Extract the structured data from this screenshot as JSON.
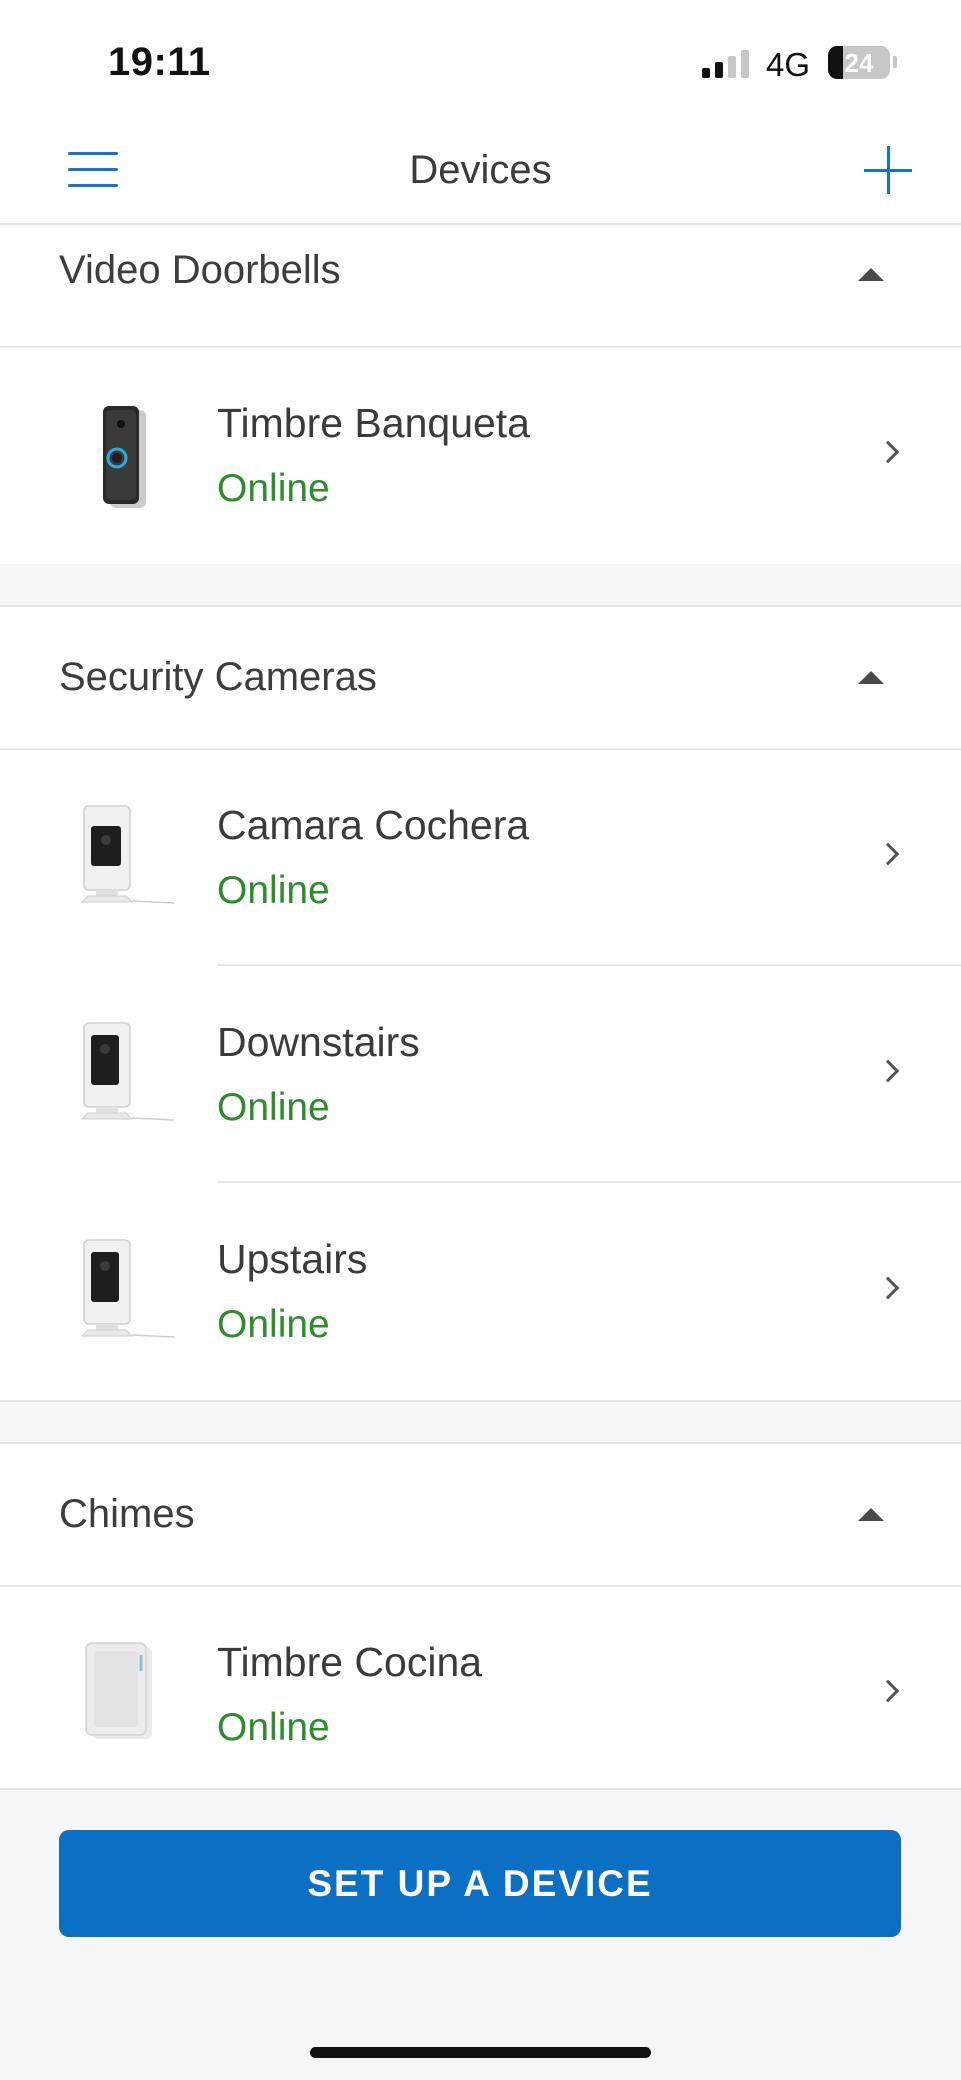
{
  "status_bar": {
    "time": "19:11",
    "network": "4G",
    "battery": "24",
    "battery_level_percent": 24
  },
  "header": {
    "title": "Devices",
    "menu_icon": "hamburger-menu-icon",
    "add_icon": "plus-icon"
  },
  "sections": [
    {
      "title": "Video Doorbells",
      "devices": [
        {
          "name": "Timbre Banqueta",
          "status": "Online",
          "icon": "video-doorbell-icon"
        }
      ]
    },
    {
      "title": "Security Cameras",
      "devices": [
        {
          "name": "Camara Cochera",
          "status": "Online",
          "icon": "indoor-camera-icon"
        },
        {
          "name": "Downstairs",
          "status": "Online",
          "icon": "indoor-camera-icon"
        },
        {
          "name": "Upstairs",
          "status": "Online",
          "icon": "indoor-camera-icon"
        }
      ]
    },
    {
      "title": "Chimes",
      "devices": [
        {
          "name": "Timbre Cocina",
          "status": "Online",
          "icon": "chime-icon"
        }
      ]
    }
  ],
  "footer": {
    "setup_button_label": "SET UP A DEVICE"
  },
  "colors": {
    "accent": "#1673c5",
    "button": "#0b6fc4",
    "online": "#2e8b2e",
    "gap_background": "#f4f6f8"
  }
}
